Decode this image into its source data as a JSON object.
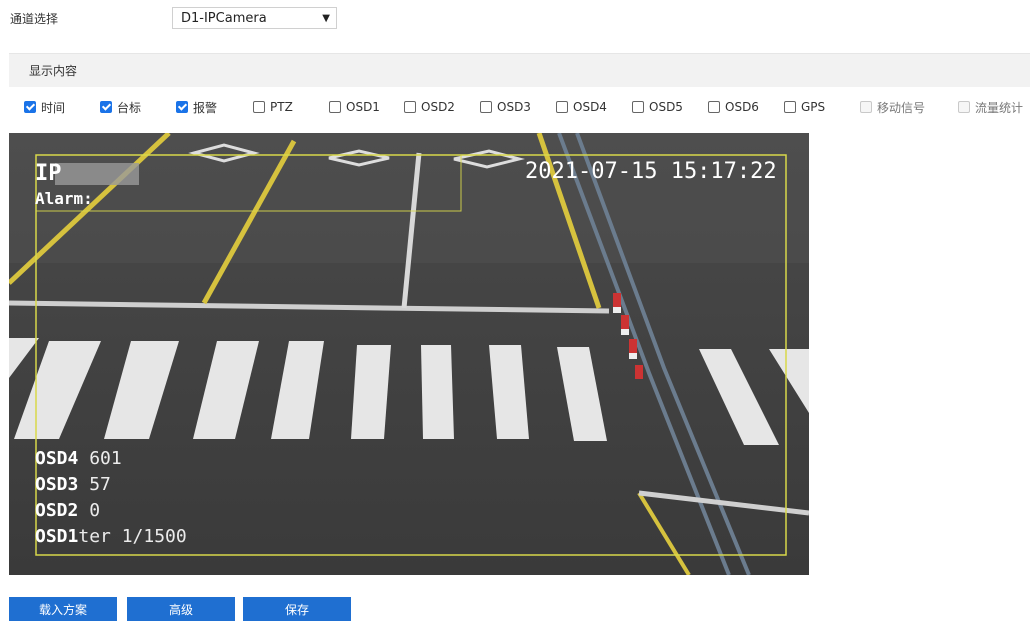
{
  "channel": {
    "label": "通道选择",
    "selected": "D1-IPCamera"
  },
  "section": {
    "title": "显示内容"
  },
  "checkboxes": [
    {
      "label": "时间",
      "checked": true,
      "disabled": false
    },
    {
      "label": "台标",
      "checked": true,
      "disabled": false
    },
    {
      "label": "报警",
      "checked": true,
      "disabled": false
    },
    {
      "label": "PTZ",
      "checked": false,
      "disabled": false
    },
    {
      "label": "OSD1",
      "checked": false,
      "disabled": false
    },
    {
      "label": "OSD2",
      "checked": false,
      "disabled": false
    },
    {
      "label": "OSD3",
      "checked": false,
      "disabled": false
    },
    {
      "label": "OSD4",
      "checked": false,
      "disabled": false
    },
    {
      "label": "OSD5",
      "checked": false,
      "disabled": false
    },
    {
      "label": "OSD6",
      "checked": false,
      "disabled": false
    },
    {
      "label": "GPS",
      "checked": false,
      "disabled": false
    },
    {
      "label": "移动信号",
      "checked": false,
      "disabled": true
    },
    {
      "label": "流量统计",
      "checked": false,
      "disabled": true
    }
  ],
  "video": {
    "osd_time": "2021-07-15 15:17:22",
    "osd_ip": "IP",
    "osd_alarm": "Alarm:",
    "osd_lines": [
      "OSD4",
      "OSD3",
      "OSD2",
      "OSD1"
    ],
    "osd_values": [
      "601",
      "57",
      "0",
      "ter  1/1500"
    ],
    "colors": {
      "osd_frame": "#d8d84a"
    }
  },
  "buttons": {
    "load": "载入方案",
    "advanced": "高级",
    "save": "保存"
  }
}
